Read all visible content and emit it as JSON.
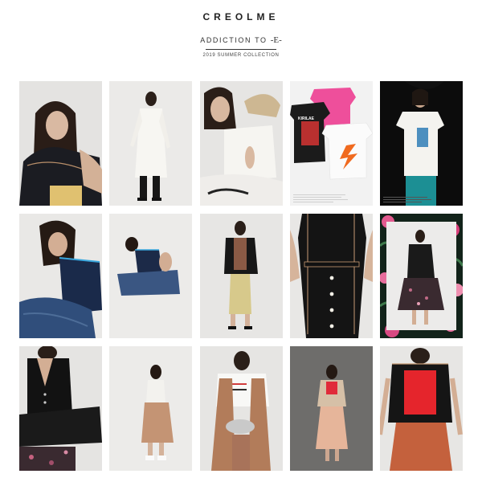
{
  "header": {
    "brand": "CREOLME",
    "subtitle_prefix": "ADDICTION TO ",
    "subtitle_mark": "-E-",
    "season": "2019 SUMMER COLLECTION"
  },
  "grid": {
    "rows": [
      [
        "look-01",
        "look-02",
        "look-03",
        "look-04-tees",
        "look-05"
      ],
      [
        "look-06",
        "look-07",
        "look-08",
        "look-09",
        "look-10-floral"
      ],
      [
        "look-11",
        "look-12",
        "look-13",
        "look-14",
        "look-15"
      ]
    ]
  },
  "tees_tile": {
    "tee_text": "KIRILAE"
  }
}
